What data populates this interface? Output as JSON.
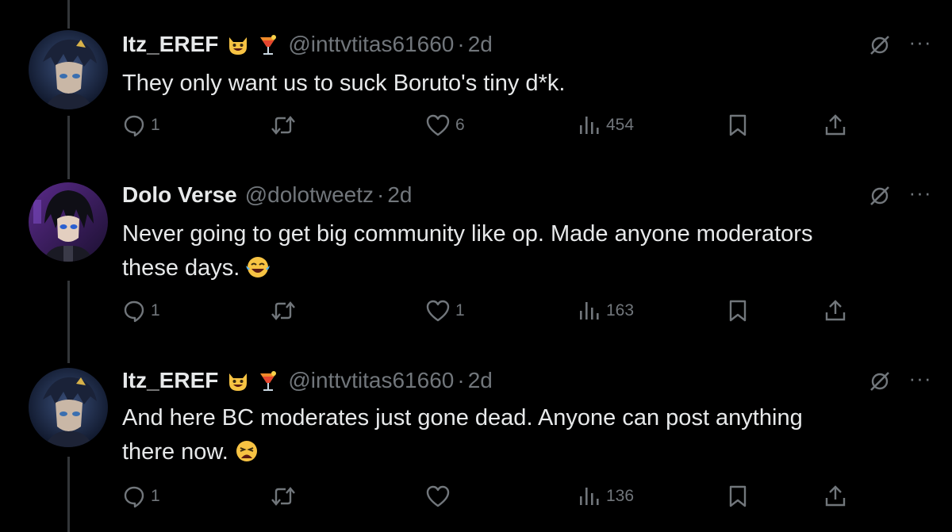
{
  "colors": {
    "background": "#000000",
    "text_primary": "#e7e9ea",
    "text_secondary": "#71767b",
    "thread_line": "#333639"
  },
  "tweets": [
    {
      "name": "Itz_EREF",
      "emojis": [
        "grinning-cat-icon",
        "tropical-drink-icon"
      ],
      "handle": "@inttvtitas61660",
      "separator": "·",
      "time": "2d",
      "lines": [
        "They only want us to suck Boruto's tiny d*k."
      ],
      "trailing_emoji": "",
      "replies": "1",
      "retweets": "",
      "likes": "6",
      "views": "454"
    },
    {
      "name": "Dolo Verse",
      "emojis": [],
      "handle": "@dolotweetz",
      "separator": "·",
      "time": "2d",
      "lines": [
        "Never going to get big community like op. Made anyone moderators",
        "these days."
      ],
      "trailing_emoji": "tears-of-joy-icon",
      "replies": "1",
      "retweets": "",
      "likes": "1",
      "views": "163"
    },
    {
      "name": "Itz_EREF",
      "emojis": [
        "grinning-cat-icon",
        "tropical-drink-icon"
      ],
      "handle": "@inttvtitas61660",
      "separator": "·",
      "time": "2d",
      "lines": [
        "And here BC moderates just gone dead. Anyone can post anything",
        "there now."
      ],
      "trailing_emoji": "weary-face-icon",
      "replies": "1",
      "retweets": "",
      "likes": "",
      "views": "136"
    }
  ],
  "more_label": "···"
}
